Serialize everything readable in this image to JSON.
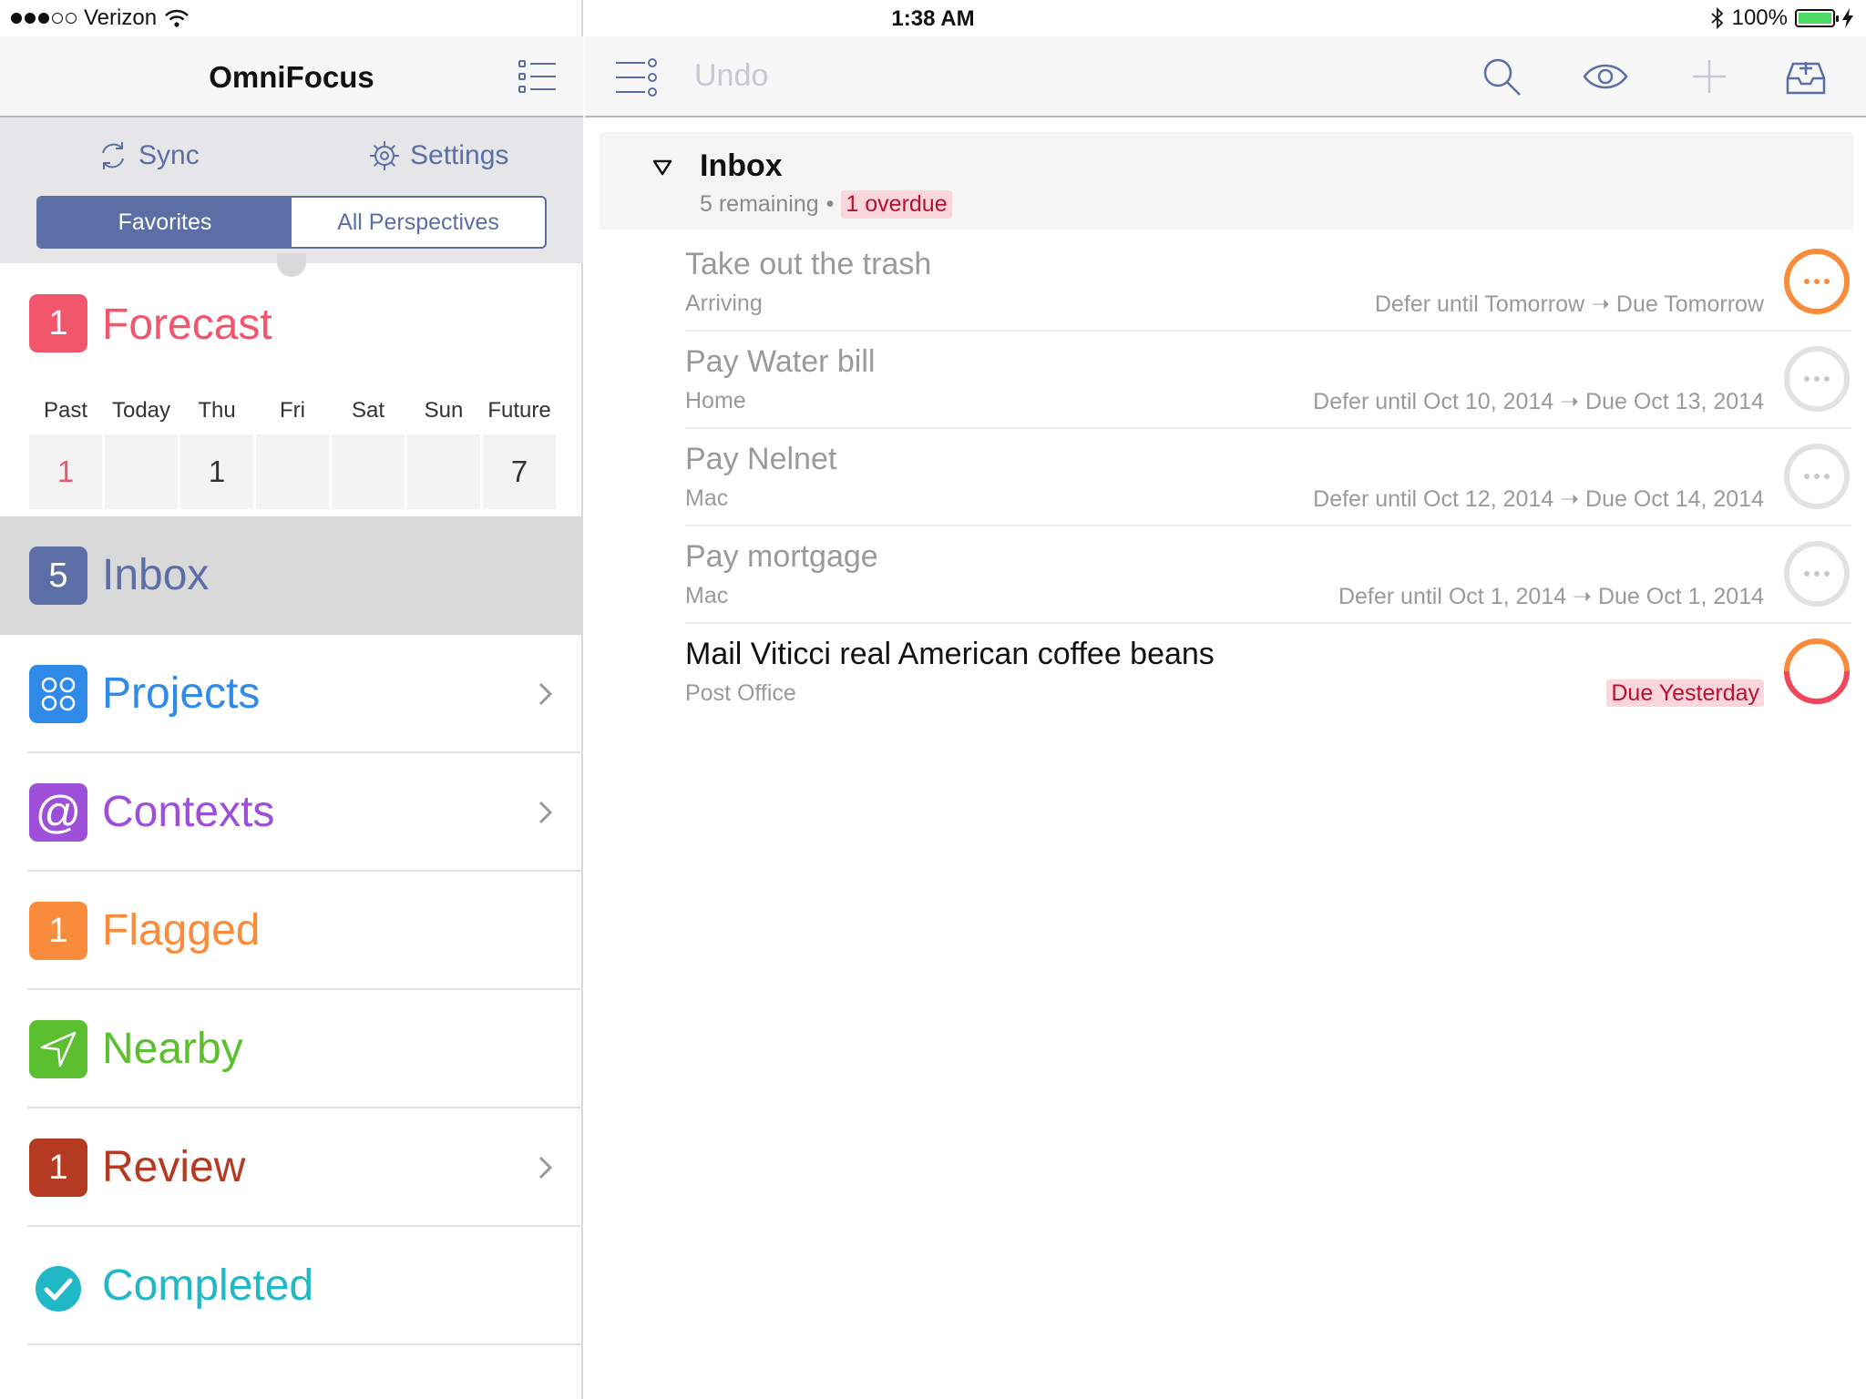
{
  "status": {
    "carrier": "Verizon",
    "time": "1:38 AM",
    "battery": "100%",
    "signal_bars": 3
  },
  "sidebar": {
    "title": "OmniFocus",
    "sync_label": "Sync",
    "settings_label": "Settings",
    "segments": [
      "Favorites",
      "All Perspectives"
    ],
    "active_segment": "Favorites",
    "forecast": {
      "badge": "1",
      "label": "Forecast",
      "color": "#f2566d",
      "days": [
        {
          "name": "Past",
          "count": "1"
        },
        {
          "name": "Today",
          "count": ""
        },
        {
          "name": "Thu",
          "count": "1"
        },
        {
          "name": "Fri",
          "count": ""
        },
        {
          "name": "Sat",
          "count": ""
        },
        {
          "name": "Sun",
          "count": ""
        },
        {
          "name": "Future",
          "count": "7"
        }
      ]
    },
    "items": [
      {
        "key": "inbox",
        "badge": "5",
        "label": "Inbox",
        "color": "#5b6fa6",
        "selected": true,
        "chevron": false
      },
      {
        "key": "projects",
        "badge": "",
        "label": "Projects",
        "color": "#2f8ae8",
        "selected": false,
        "chevron": true
      },
      {
        "key": "contexts",
        "badge": "",
        "label": "Contexts",
        "color": "#9d4fd9",
        "selected": false,
        "chevron": true
      },
      {
        "key": "flagged",
        "badge": "1",
        "label": "Flagged",
        "color": "#f98c3c",
        "selected": false,
        "chevron": false
      },
      {
        "key": "nearby",
        "badge": "",
        "label": "Nearby",
        "color": "#5bbf2f",
        "selected": false,
        "chevron": false
      },
      {
        "key": "review",
        "badge": "1",
        "label": "Review",
        "color": "#b53a22",
        "selected": false,
        "chevron": true
      },
      {
        "key": "completed",
        "badge": "",
        "label": "Completed",
        "color": "#20b7c7",
        "selected": false,
        "chevron": false
      }
    ]
  },
  "toolbar": {
    "undo_label": "Undo",
    "icons": [
      "search-icon",
      "eye-icon",
      "plus-icon",
      "inbox-add-icon"
    ]
  },
  "inbox": {
    "title": "Inbox",
    "remaining": "5 remaining",
    "separator": "•",
    "overdue": "1 overdue"
  },
  "tasks": [
    {
      "title": "Take out the trash",
      "context": "Arriving",
      "dates": "Defer until Tomorrow ➝ Due Tomorrow",
      "status": "deferred",
      "ring": "#f98c3c"
    },
    {
      "title": "Pay Water bill",
      "context": "Home",
      "dates": "Defer until Oct 10, 2014 ➝ Due Oct 13, 2014",
      "status": "deferred",
      "ring": "#e2e2e2"
    },
    {
      "title": "Pay Nelnet",
      "context": "Mac",
      "dates": "Defer until Oct 12, 2014 ➝ Due Oct 14, 2014",
      "status": "deferred",
      "ring": "#e2e2e2"
    },
    {
      "title": "Pay mortgage",
      "context": "Mac",
      "dates": "Defer until Oct 1, 2014 ➝ Due Oct 1, 2014",
      "status": "deferred",
      "ring": "#e2e2e2"
    },
    {
      "title": "Mail Viticci real American coffee beans",
      "context": "Post Office",
      "dates": "Due Yesterday",
      "status": "overdue",
      "ring": "#f98c3c"
    }
  ]
}
